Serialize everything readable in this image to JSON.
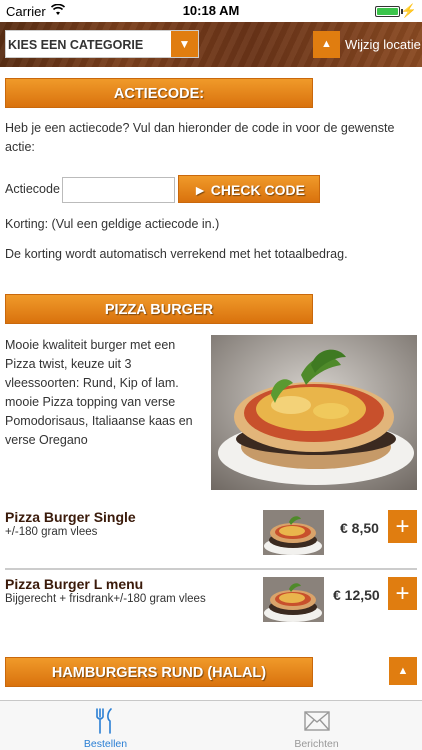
{
  "status_bar": {
    "carrier": "Carrier",
    "time": "10:18 AM"
  },
  "header": {
    "category_select": "KIES EEN CATEGORIE",
    "location_label": "Wijzig locatie"
  },
  "promo": {
    "title": "ACTIECODE:",
    "intro": "Heb je een actiecode? Vul dan hieronder de code in voor de gewenste actie:",
    "field_label": "Actiecode",
    "field_value": "",
    "check_button": "► CHECK CODE",
    "discount": "Korting: (Vul een geldige actiecode in.)",
    "note": "De korting wordt automatisch verrekend met het totaalbedrag."
  },
  "category": {
    "title": "PIZZA BURGER",
    "description": "Mooie kwaliteit burger met een Pizza twist, keuze uit 3 vleessoorten: Rund, Kip of lam. mooie Pizza topping van verse Pomodorisaus, Italiaanse kaas en verse Oregano",
    "items": [
      {
        "name": "Pizza Burger Single",
        "sub": "+/-180 gram vlees",
        "price": "€ 8,50"
      },
      {
        "name": "Pizza Burger L menu",
        "sub": "Bijgerecht + frisdrank+/-180 gram vlees",
        "price": "€ 12,50"
      }
    ]
  },
  "next_category": {
    "title": "HAMBURGERS RUND (HALAL)"
  },
  "tabs": [
    {
      "label": "Bestellen",
      "icon": "cutlery-icon",
      "active": true
    },
    {
      "label": "Berichten",
      "icon": "envelope-icon",
      "active": false
    }
  ],
  "colors": {
    "accent": "#e07d10",
    "active_tab": "#2a7fd4",
    "inactive_tab": "#999999"
  }
}
